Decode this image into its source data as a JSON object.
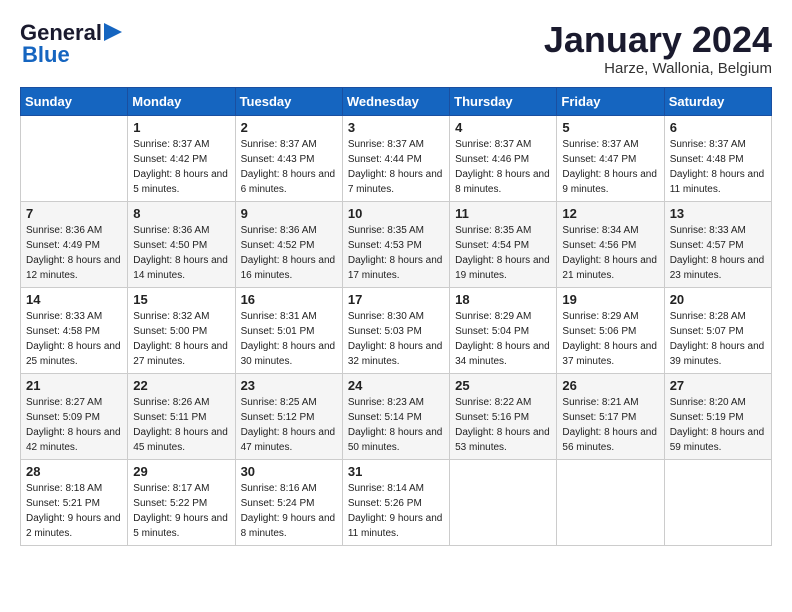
{
  "header": {
    "logo_general": "General",
    "logo_blue": "Blue",
    "month": "January 2024",
    "location": "Harze, Wallonia, Belgium"
  },
  "weekdays": [
    "Sunday",
    "Monday",
    "Tuesday",
    "Wednesday",
    "Thursday",
    "Friday",
    "Saturday"
  ],
  "weeks": [
    [
      {
        "day": "",
        "sunrise": "",
        "sunset": "",
        "daylight": ""
      },
      {
        "day": "1",
        "sunrise": "Sunrise: 8:37 AM",
        "sunset": "Sunset: 4:42 PM",
        "daylight": "Daylight: 8 hours and 5 minutes."
      },
      {
        "day": "2",
        "sunrise": "Sunrise: 8:37 AM",
        "sunset": "Sunset: 4:43 PM",
        "daylight": "Daylight: 8 hours and 6 minutes."
      },
      {
        "day": "3",
        "sunrise": "Sunrise: 8:37 AM",
        "sunset": "Sunset: 4:44 PM",
        "daylight": "Daylight: 8 hours and 7 minutes."
      },
      {
        "day": "4",
        "sunrise": "Sunrise: 8:37 AM",
        "sunset": "Sunset: 4:46 PM",
        "daylight": "Daylight: 8 hours and 8 minutes."
      },
      {
        "day": "5",
        "sunrise": "Sunrise: 8:37 AM",
        "sunset": "Sunset: 4:47 PM",
        "daylight": "Daylight: 8 hours and 9 minutes."
      },
      {
        "day": "6",
        "sunrise": "Sunrise: 8:37 AM",
        "sunset": "Sunset: 4:48 PM",
        "daylight": "Daylight: 8 hours and 11 minutes."
      }
    ],
    [
      {
        "day": "7",
        "sunrise": "Sunrise: 8:36 AM",
        "sunset": "Sunset: 4:49 PM",
        "daylight": "Daylight: 8 hours and 12 minutes."
      },
      {
        "day": "8",
        "sunrise": "Sunrise: 8:36 AM",
        "sunset": "Sunset: 4:50 PM",
        "daylight": "Daylight: 8 hours and 14 minutes."
      },
      {
        "day": "9",
        "sunrise": "Sunrise: 8:36 AM",
        "sunset": "Sunset: 4:52 PM",
        "daylight": "Daylight: 8 hours and 16 minutes."
      },
      {
        "day": "10",
        "sunrise": "Sunrise: 8:35 AM",
        "sunset": "Sunset: 4:53 PM",
        "daylight": "Daylight: 8 hours and 17 minutes."
      },
      {
        "day": "11",
        "sunrise": "Sunrise: 8:35 AM",
        "sunset": "Sunset: 4:54 PM",
        "daylight": "Daylight: 8 hours and 19 minutes."
      },
      {
        "day": "12",
        "sunrise": "Sunrise: 8:34 AM",
        "sunset": "Sunset: 4:56 PM",
        "daylight": "Daylight: 8 hours and 21 minutes."
      },
      {
        "day": "13",
        "sunrise": "Sunrise: 8:33 AM",
        "sunset": "Sunset: 4:57 PM",
        "daylight": "Daylight: 8 hours and 23 minutes."
      }
    ],
    [
      {
        "day": "14",
        "sunrise": "Sunrise: 8:33 AM",
        "sunset": "Sunset: 4:58 PM",
        "daylight": "Daylight: 8 hours and 25 minutes."
      },
      {
        "day": "15",
        "sunrise": "Sunrise: 8:32 AM",
        "sunset": "Sunset: 5:00 PM",
        "daylight": "Daylight: 8 hours and 27 minutes."
      },
      {
        "day": "16",
        "sunrise": "Sunrise: 8:31 AM",
        "sunset": "Sunset: 5:01 PM",
        "daylight": "Daylight: 8 hours and 30 minutes."
      },
      {
        "day": "17",
        "sunrise": "Sunrise: 8:30 AM",
        "sunset": "Sunset: 5:03 PM",
        "daylight": "Daylight: 8 hours and 32 minutes."
      },
      {
        "day": "18",
        "sunrise": "Sunrise: 8:29 AM",
        "sunset": "Sunset: 5:04 PM",
        "daylight": "Daylight: 8 hours and 34 minutes."
      },
      {
        "day": "19",
        "sunrise": "Sunrise: 8:29 AM",
        "sunset": "Sunset: 5:06 PM",
        "daylight": "Daylight: 8 hours and 37 minutes."
      },
      {
        "day": "20",
        "sunrise": "Sunrise: 8:28 AM",
        "sunset": "Sunset: 5:07 PM",
        "daylight": "Daylight: 8 hours and 39 minutes."
      }
    ],
    [
      {
        "day": "21",
        "sunrise": "Sunrise: 8:27 AM",
        "sunset": "Sunset: 5:09 PM",
        "daylight": "Daylight: 8 hours and 42 minutes."
      },
      {
        "day": "22",
        "sunrise": "Sunrise: 8:26 AM",
        "sunset": "Sunset: 5:11 PM",
        "daylight": "Daylight: 8 hours and 45 minutes."
      },
      {
        "day": "23",
        "sunrise": "Sunrise: 8:25 AM",
        "sunset": "Sunset: 5:12 PM",
        "daylight": "Daylight: 8 hours and 47 minutes."
      },
      {
        "day": "24",
        "sunrise": "Sunrise: 8:23 AM",
        "sunset": "Sunset: 5:14 PM",
        "daylight": "Daylight: 8 hours and 50 minutes."
      },
      {
        "day": "25",
        "sunrise": "Sunrise: 8:22 AM",
        "sunset": "Sunset: 5:16 PM",
        "daylight": "Daylight: 8 hours and 53 minutes."
      },
      {
        "day": "26",
        "sunrise": "Sunrise: 8:21 AM",
        "sunset": "Sunset: 5:17 PM",
        "daylight": "Daylight: 8 hours and 56 minutes."
      },
      {
        "day": "27",
        "sunrise": "Sunrise: 8:20 AM",
        "sunset": "Sunset: 5:19 PM",
        "daylight": "Daylight: 8 hours and 59 minutes."
      }
    ],
    [
      {
        "day": "28",
        "sunrise": "Sunrise: 8:18 AM",
        "sunset": "Sunset: 5:21 PM",
        "daylight": "Daylight: 9 hours and 2 minutes."
      },
      {
        "day": "29",
        "sunrise": "Sunrise: 8:17 AM",
        "sunset": "Sunset: 5:22 PM",
        "daylight": "Daylight: 9 hours and 5 minutes."
      },
      {
        "day": "30",
        "sunrise": "Sunrise: 8:16 AM",
        "sunset": "Sunset: 5:24 PM",
        "daylight": "Daylight: 9 hours and 8 minutes."
      },
      {
        "day": "31",
        "sunrise": "Sunrise: 8:14 AM",
        "sunset": "Sunset: 5:26 PM",
        "daylight": "Daylight: 9 hours and 11 minutes."
      },
      {
        "day": "",
        "sunrise": "",
        "sunset": "",
        "daylight": ""
      },
      {
        "day": "",
        "sunrise": "",
        "sunset": "",
        "daylight": ""
      },
      {
        "day": "",
        "sunrise": "",
        "sunset": "",
        "daylight": ""
      }
    ]
  ]
}
